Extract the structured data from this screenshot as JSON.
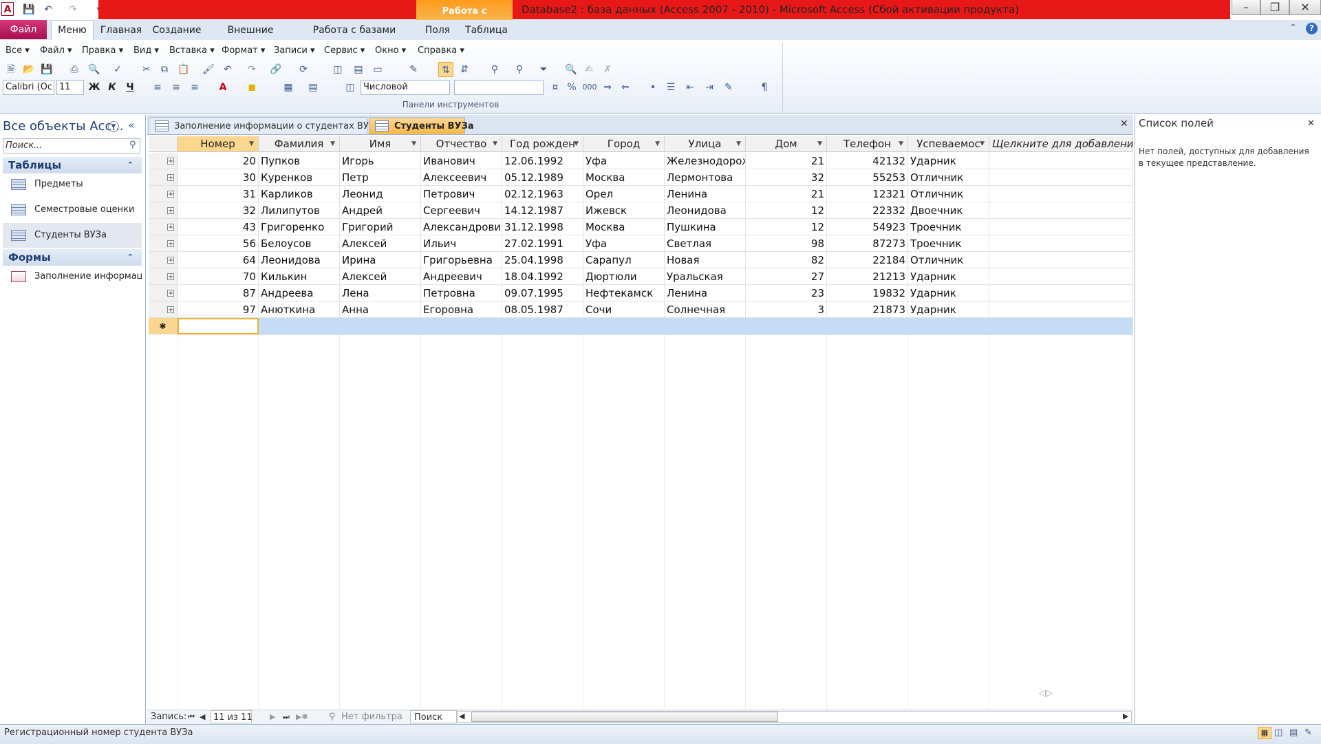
{
  "window": {
    "title": "Database2 : база данных (Access 2007 - 2010)  -  Microsoft Access (Сбой активации продукта)",
    "context_tab": "Работа с таблицами",
    "app_icon": "A"
  },
  "ribbon_tabs": [
    "Файл",
    "Меню",
    "Главная",
    "Создание",
    "Внешние данные",
    "Работа с базами данных",
    "Поля",
    "Таблица"
  ],
  "menus": [
    "Все",
    "Файл",
    "Правка",
    "Вид",
    "Вставка",
    "Формат",
    "Записи",
    "Сервис",
    "Окно",
    "Справка"
  ],
  "toolbar": {
    "font_name": "Calibri (Ос",
    "font_size": "11",
    "bold": "Ж",
    "italic": "К",
    "underline": "Ч",
    "number_format": "Числовой",
    "group_label": "Панели инструментов",
    "percent": "%",
    "thousands": "000"
  },
  "nav": {
    "title": "Все объекты Асс...",
    "search_placeholder": "Поиск...",
    "groups": [
      {
        "label": "Таблицы",
        "items": [
          "Предметы",
          "Семестровые оценки",
          "Студенты ВУЗа"
        ]
      },
      {
        "label": "Формы",
        "items": [
          "Заполнение информац..."
        ]
      }
    ]
  },
  "doc_tabs": [
    "Заполнение информации о студентах ВУЗа",
    "Студенты ВУЗа"
  ],
  "table": {
    "columns": [
      "Номер",
      "Фамилия",
      "Имя",
      "Отчество",
      "Год рожден",
      "Город",
      "Улица",
      "Дом",
      "Телефон",
      "Успеваемос",
      "Щелкните для добавления"
    ],
    "rows": [
      [
        "20",
        "Пупков",
        "Игорь",
        "Иванович",
        "12.06.1992",
        "Уфа",
        "Железнодорож",
        "21",
        "42132",
        "Ударник"
      ],
      [
        "30",
        "Куренков",
        "Петр",
        "Алексеевич",
        "05.12.1989",
        "Москва",
        "Лермонтова",
        "32",
        "55253",
        "Отличник"
      ],
      [
        "31",
        "Карликов",
        "Леонид",
        "Петрович",
        "02.12.1963",
        "Орел",
        "Ленина",
        "21",
        "12321",
        "Отличник"
      ],
      [
        "32",
        "Лилипутов",
        "Андрей",
        "Сергеевич",
        "14.12.1987",
        "Ижевск",
        "Леонидова",
        "12",
        "22332",
        "Двоечник"
      ],
      [
        "43",
        "Григоренко",
        "Григорий",
        "Александрович",
        "31.12.1998",
        "Москва",
        "Пушкина",
        "12",
        "54923",
        "Троечник"
      ],
      [
        "56",
        "Белоусов",
        "Алексей",
        "Ильич",
        "27.02.1991",
        "Уфа",
        "Светлая",
        "98",
        "87273",
        "Троечник"
      ],
      [
        "64",
        "Леонидова",
        "Ирина",
        "Григорьевна",
        "25.04.1998",
        "Сарапул",
        "Новая",
        "82",
        "22184",
        "Отличник"
      ],
      [
        "70",
        "Килькин",
        "Алексей",
        "Андреевич",
        "18.04.1992",
        "Дюртюли",
        "Уральская",
        "27",
        "21213",
        "Ударник"
      ],
      [
        "87",
        "Андреева",
        "Лена",
        "Петровна",
        "09.07.1995",
        "Нефтекамск",
        "Ленина",
        "23",
        "19832",
        "Ударник"
      ],
      [
        "97",
        "Анюткина",
        "Анна",
        "Егоровна",
        "08.05.1987",
        "Сочи",
        "Солнечная",
        "3",
        "21873",
        "Ударник"
      ]
    ],
    "new_row_marker": "✱"
  },
  "field_list": {
    "title": "Список полей",
    "message": "Нет полей, доступных для добавления в текущее представление."
  },
  "record_nav": {
    "label": "Запись:",
    "position": "11 из 11",
    "filter": "Нет фильтра",
    "search": "Поиск"
  },
  "status": {
    "text": "Регистрационный номер студента ВУЗа"
  }
}
